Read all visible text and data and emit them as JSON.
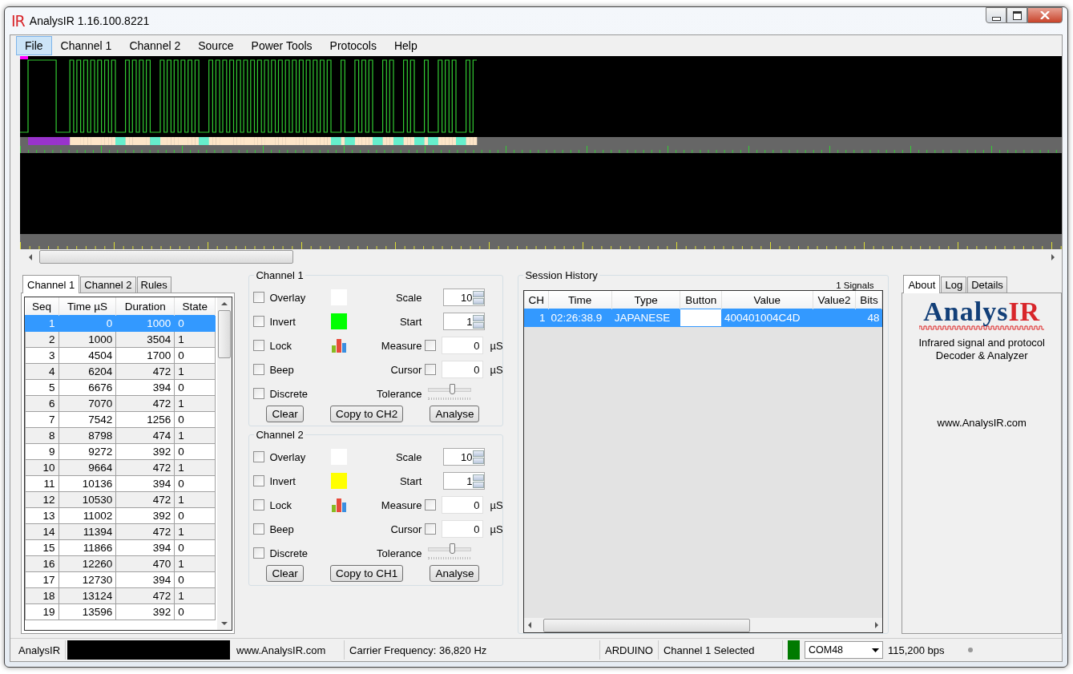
{
  "window": {
    "logo": "IR",
    "title": "AnalysIR 1.16.100.8221"
  },
  "menu": [
    {
      "label": "File",
      "selected": true
    },
    {
      "label": "Channel 1",
      "selected": false
    },
    {
      "label": "Channel 2",
      "selected": false
    },
    {
      "label": "Source",
      "selected": false
    },
    {
      "label": "Power Tools",
      "selected": false
    },
    {
      "label": "Protocols",
      "selected": false
    },
    {
      "label": "Help",
      "selected": false
    }
  ],
  "left_tabs": [
    {
      "label": "Channel 1",
      "selected": true
    },
    {
      "label": "Channel 2",
      "selected": false
    },
    {
      "label": "Rules",
      "selected": false
    }
  ],
  "timing_table": {
    "columns": [
      "Seq",
      "Time µS",
      "Duration",
      "State"
    ],
    "rows": [
      {
        "cells": [
          "1",
          "0",
          "1000",
          "0"
        ],
        "selected": true
      },
      {
        "cells": [
          "2",
          "1000",
          "3504",
          "1"
        ],
        "selected": false
      },
      {
        "cells": [
          "3",
          "4504",
          "1700",
          "0"
        ],
        "selected": false
      },
      {
        "cells": [
          "4",
          "6204",
          "472",
          "1"
        ],
        "selected": false
      },
      {
        "cells": [
          "5",
          "6676",
          "394",
          "0"
        ],
        "selected": false
      },
      {
        "cells": [
          "6",
          "7070",
          "472",
          "1"
        ],
        "selected": false
      },
      {
        "cells": [
          "7",
          "7542",
          "1256",
          "0"
        ],
        "selected": false
      },
      {
        "cells": [
          "8",
          "8798",
          "474",
          "1"
        ],
        "selected": false
      },
      {
        "cells": [
          "9",
          "9272",
          "392",
          "0"
        ],
        "selected": false
      },
      {
        "cells": [
          "10",
          "9664",
          "472",
          "1"
        ],
        "selected": false
      },
      {
        "cells": [
          "11",
          "10136",
          "394",
          "0"
        ],
        "selected": false
      },
      {
        "cells": [
          "12",
          "10530",
          "472",
          "1"
        ],
        "selected": false
      },
      {
        "cells": [
          "13",
          "11002",
          "392",
          "0"
        ],
        "selected": false
      },
      {
        "cells": [
          "14",
          "11394",
          "472",
          "1"
        ],
        "selected": false
      },
      {
        "cells": [
          "15",
          "11866",
          "394",
          "0"
        ],
        "selected": false
      },
      {
        "cells": [
          "16",
          "12260",
          "470",
          "1"
        ],
        "selected": false
      },
      {
        "cells": [
          "17",
          "12730",
          "394",
          "0"
        ],
        "selected": false
      },
      {
        "cells": [
          "18",
          "13124",
          "472",
          "1"
        ],
        "selected": false
      },
      {
        "cells": [
          "19",
          "13596",
          "392",
          "0"
        ],
        "selected": false
      }
    ]
  },
  "channels": [
    {
      "title": "Channel 1",
      "options": [
        {
          "label": "Overlay",
          "checked": false
        },
        {
          "label": "Invert",
          "checked": false
        },
        {
          "label": "Lock",
          "checked": false
        },
        {
          "label": "Beep",
          "checked": false
        },
        {
          "label": "Discrete",
          "checked": false
        }
      ],
      "swatches": [
        {
          "color": "#ffffff"
        },
        {
          "color": "#00ff00"
        }
      ],
      "scale": {
        "label": "Scale",
        "value": "10"
      },
      "start": {
        "label": "Start",
        "value": "1"
      },
      "measure": {
        "label": "Measure",
        "checked": false,
        "value": "0",
        "unit": "µS"
      },
      "cursor": {
        "label": "Cursor",
        "checked": false,
        "value": "0",
        "unit": "µS"
      },
      "tolerance": {
        "label": "Tolerance",
        "level": 0.55
      },
      "buttons": [
        "Clear",
        "Copy to CH2",
        "Analyse"
      ]
    },
    {
      "title": "Channel 2",
      "options": [
        {
          "label": "Overlay",
          "checked": false
        },
        {
          "label": "Invert",
          "checked": false
        },
        {
          "label": "Lock",
          "checked": false
        },
        {
          "label": "Beep",
          "checked": false
        },
        {
          "label": "Discrete",
          "checked": false
        }
      ],
      "swatches": [
        {
          "color": "#ffffff"
        },
        {
          "color": "#ffff00"
        }
      ],
      "scale": {
        "label": "Scale",
        "value": "10"
      },
      "start": {
        "label": "Start",
        "value": "1"
      },
      "measure": {
        "label": "Measure",
        "checked": false,
        "value": "0",
        "unit": "µS"
      },
      "cursor": {
        "label": "Cursor",
        "checked": false,
        "value": "0",
        "unit": "µS"
      },
      "tolerance": {
        "label": "Tolerance",
        "level": 0.55
      },
      "buttons": [
        "Clear",
        "Copy to CH1",
        "Analyse"
      ]
    }
  ],
  "session_history": {
    "title": "Session History",
    "count": "1 Signals",
    "columns": [
      "CH",
      "Time",
      "Type",
      "Button",
      "Value",
      "Value2",
      "Bits"
    ],
    "rows": [
      {
        "cells": [
          "1",
          "02:26:38.9",
          "JAPANESE",
          null,
          "400401004C4D",
          null,
          "48"
        ],
        "selected": true
      }
    ]
  },
  "about_panel": {
    "tabs": [
      {
        "label": "About",
        "selected": true
      },
      {
        "label": "Log",
        "selected": false
      },
      {
        "label": "Details",
        "selected": false
      }
    ],
    "logo": [
      "Analys",
      "IR"
    ],
    "description": "Infrared signal and protocol Decoder & Analyzer",
    "website": "www.AnalysIR.com"
  },
  "status_bar": {
    "app": "AnalysIR",
    "website": "www.AnalysIR.com",
    "carrier": "Carrier Frequency: 36,820 Hz",
    "device": "ARDUINO",
    "selection": "Channel 1 Selected",
    "indicator": {
      "color": "#007a00"
    },
    "port": "COM48",
    "baud": "115,200 bps"
  }
}
